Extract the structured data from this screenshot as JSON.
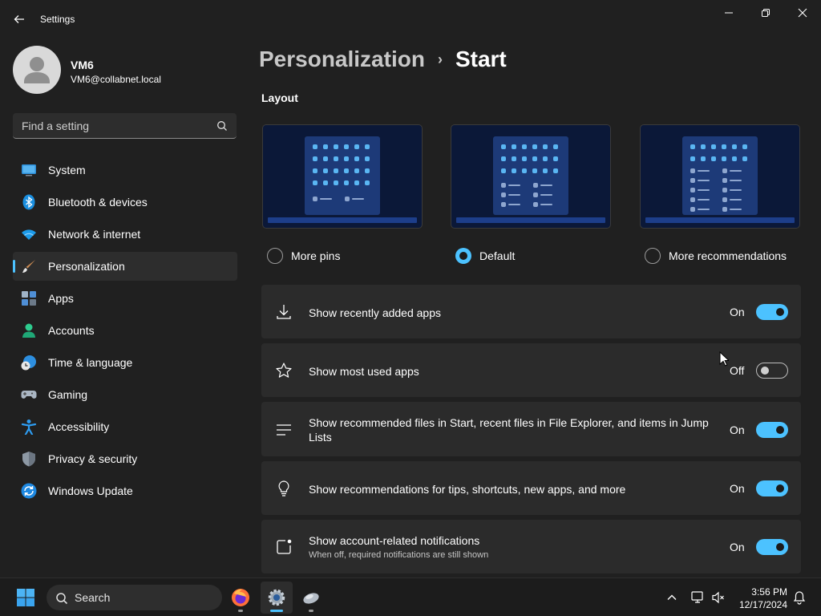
{
  "window": {
    "title": "Settings"
  },
  "profile": {
    "name": "VM6",
    "email": "VM6@collabnet.local"
  },
  "search": {
    "placeholder": "Find a setting"
  },
  "nav": {
    "items": [
      {
        "label": "System",
        "icon": "system-icon"
      },
      {
        "label": "Bluetooth & devices",
        "icon": "bluetooth-icon"
      },
      {
        "label": "Network & internet",
        "icon": "wifi-icon"
      },
      {
        "label": "Personalization",
        "icon": "paintbrush-icon",
        "selected": true
      },
      {
        "label": "Apps",
        "icon": "apps-icon"
      },
      {
        "label": "Accounts",
        "icon": "person-icon"
      },
      {
        "label": "Time & language",
        "icon": "globe-clock-icon"
      },
      {
        "label": "Gaming",
        "icon": "controller-icon"
      },
      {
        "label": "Accessibility",
        "icon": "accessibility-icon"
      },
      {
        "label": "Privacy & security",
        "icon": "shield-icon"
      },
      {
        "label": "Windows Update",
        "icon": "update-icon"
      }
    ]
  },
  "breadcrumb": {
    "parent": "Personalization",
    "separator": "›",
    "current": "Start"
  },
  "layout": {
    "title": "Layout",
    "options": [
      {
        "label": "More pins",
        "selected": false
      },
      {
        "label": "Default",
        "selected": true
      },
      {
        "label": "More recommendations",
        "selected": false
      }
    ]
  },
  "settings": [
    {
      "label": "Show recently added apps",
      "state": "On",
      "on": true,
      "icon": "download-icon"
    },
    {
      "label": "Show most used apps",
      "state": "Off",
      "on": false,
      "icon": "star-icon"
    },
    {
      "label": "Show recommended files in Start, recent files in File Explorer, and items in Jump Lists",
      "state": "On",
      "on": true,
      "icon": "list-icon"
    },
    {
      "label": "Show recommendations for tips, shortcuts, new apps, and more",
      "state": "On",
      "on": true,
      "icon": "lightbulb-icon"
    },
    {
      "label": "Show account-related notifications",
      "sublabel": "When off, required notifications are still shown",
      "state": "On",
      "on": true,
      "icon": "notification-icon"
    }
  ],
  "taskbar": {
    "search_label": "Search",
    "time": "3:56 PM",
    "date": "12/17/2024"
  },
  "colors": {
    "accent": "#4cc2ff",
    "background": "#202020",
    "card": "#2b2b2b",
    "taskbar": "#1c1c1c"
  }
}
